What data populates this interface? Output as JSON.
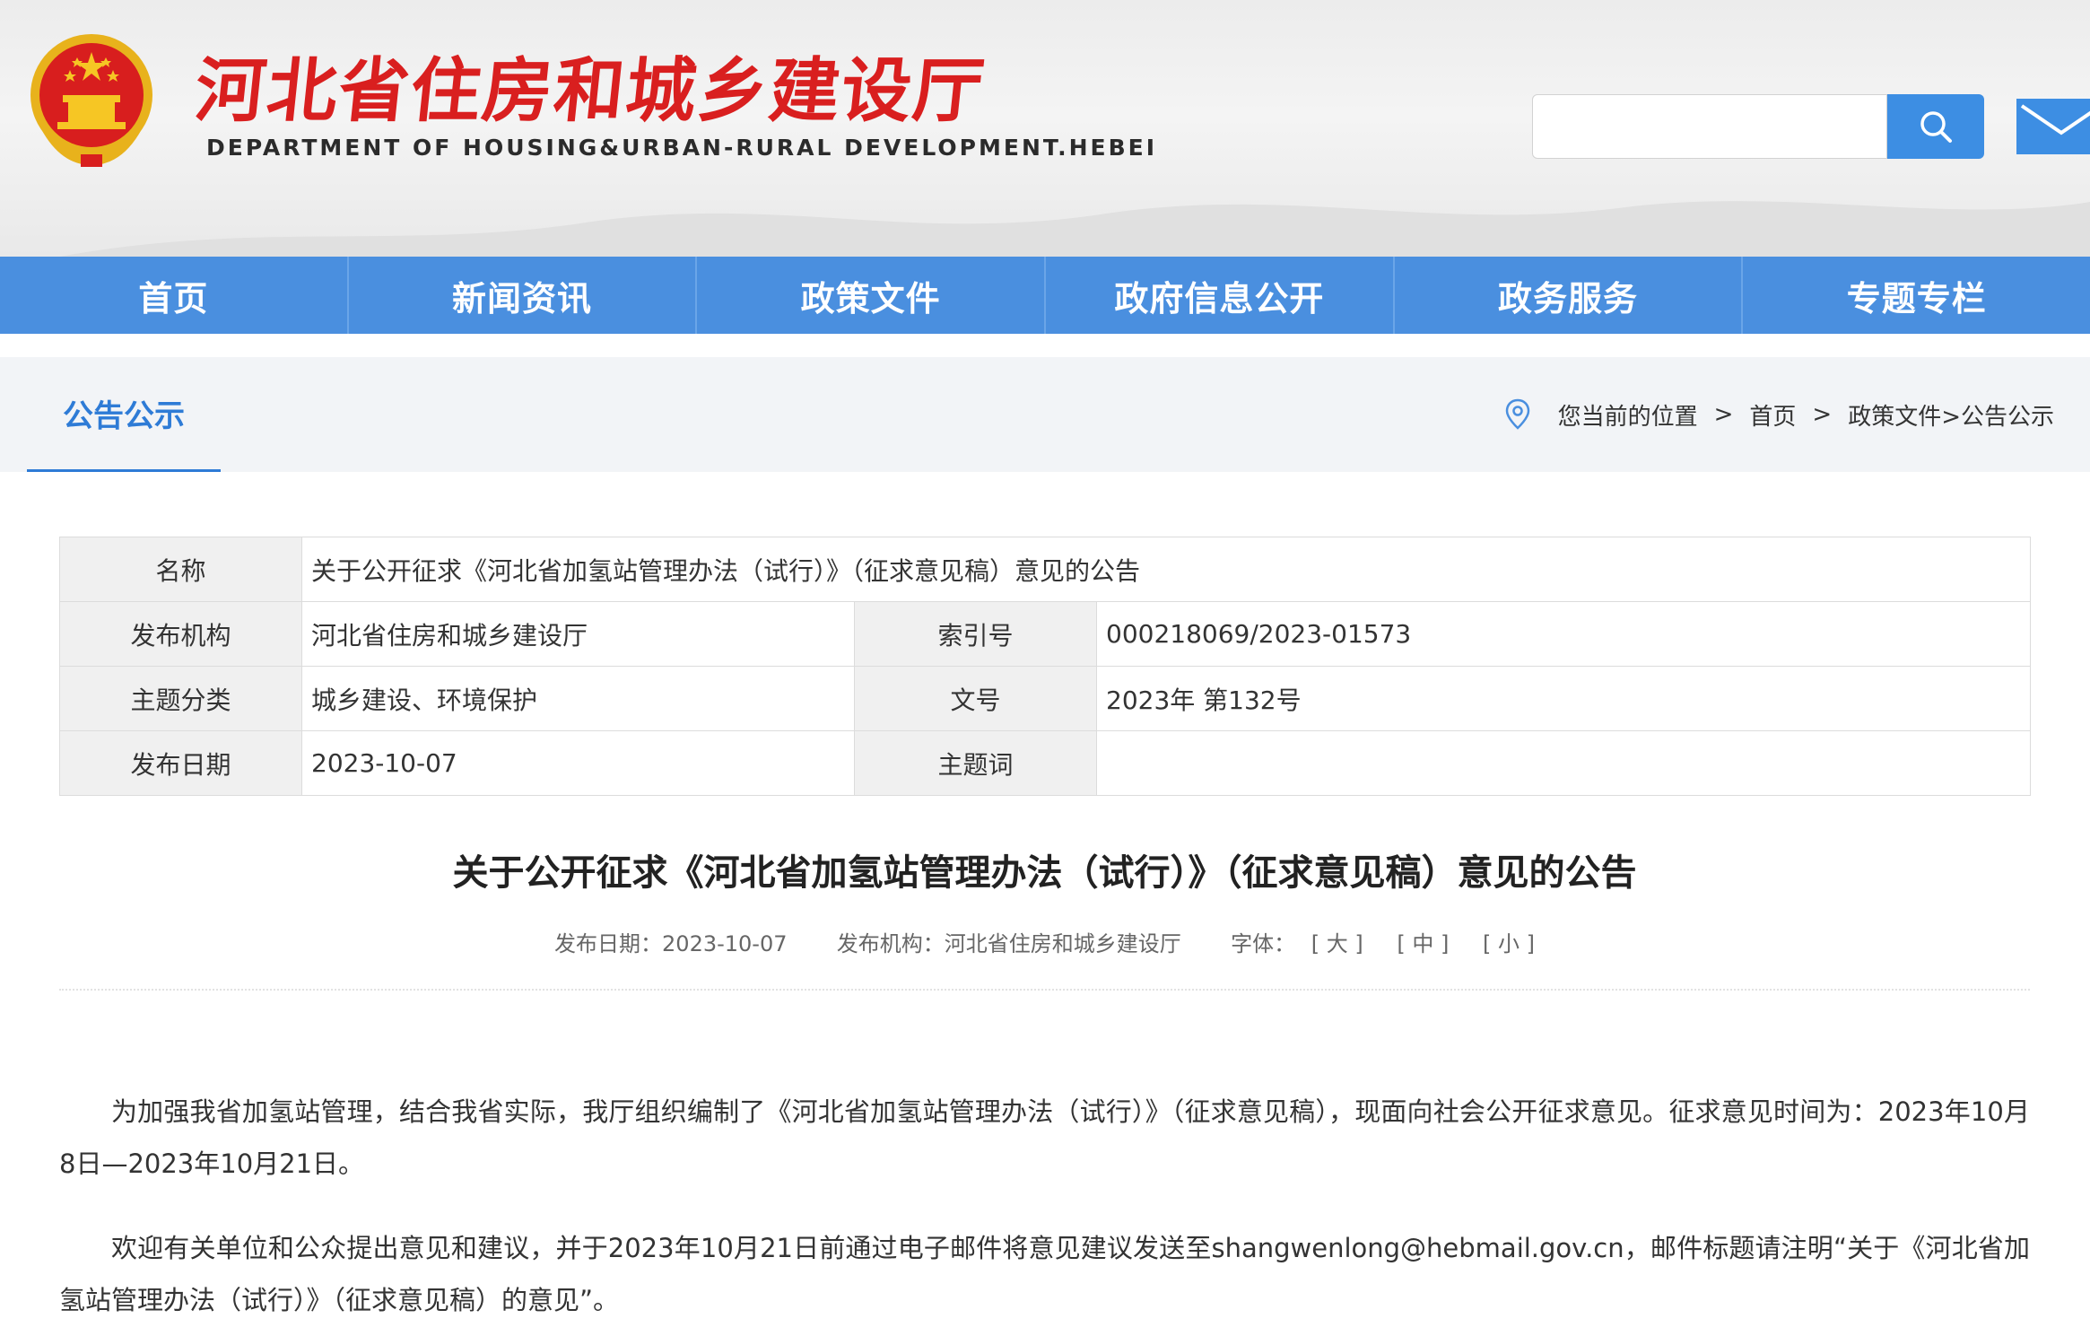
{
  "header": {
    "title": "河北省住房和城乡建设厅",
    "subtitle": "DEPARTMENT OF HOUSING&URBAN-RURAL DEVELOPMENT.HEBEI",
    "search_placeholder": "",
    "colors": {
      "title_red": "#d91f1f",
      "accent_blue": "#4a8fdf"
    }
  },
  "nav": {
    "items": [
      "首页",
      "新闻资讯",
      "政策文件",
      "政府信息公开",
      "政务服务",
      "专题专栏"
    ]
  },
  "breadcrumb": {
    "section_title": "公告公示",
    "prefix": "您当前的位置",
    "sep": ">",
    "home": "首页",
    "path": "政策文件>公告公示"
  },
  "info_table": {
    "name_label": "名称",
    "name_value": "关于公开征求《河北省加氢站管理办法（试行）》（征求意见稿）意见的公告",
    "publisher_label": "发布机构",
    "publisher_value": "河北省住房和城乡建设厅",
    "index_label": "索引号",
    "index_value": "000218069/2023-01573",
    "topic_label": "主题分类",
    "topic_value": "城乡建设、环境保护",
    "docno_label": "文号",
    "docno_value": "2023年 第132号",
    "date_label": "发布日期",
    "date_value": "2023-10-07",
    "keyword_label": "主题词",
    "keyword_value": ""
  },
  "article": {
    "title": "关于公开征求《河北省加氢站管理办法（试行）》（征求意见稿）意见的公告",
    "meta_date": "发布日期：2023-10-07",
    "meta_publisher": "发布机构：河北省住房和城乡建设厅",
    "font_label": "字体：",
    "font_large": "[ 大 ]",
    "font_medium": "[ 中 ]",
    "font_small": "[ 小 ]",
    "paragraphs": [
      "为加强我省加氢站管理，结合我省实际，我厅组织编制了《河北省加氢站管理办法（试行）》（征求意见稿），现面向社会公开征求意见。征求意见时间为：2023年10月8日—2023年10月21日。",
      "欢迎有关单位和公众提出意见和建议，并于2023年10月21日前通过电子邮件将意见建议发送至shangwenlong@hebmail.gov.cn，邮件标题请注明“关于《河北省加氢站管理办法（试行）》（征求意见稿）的意见”。"
    ]
  }
}
